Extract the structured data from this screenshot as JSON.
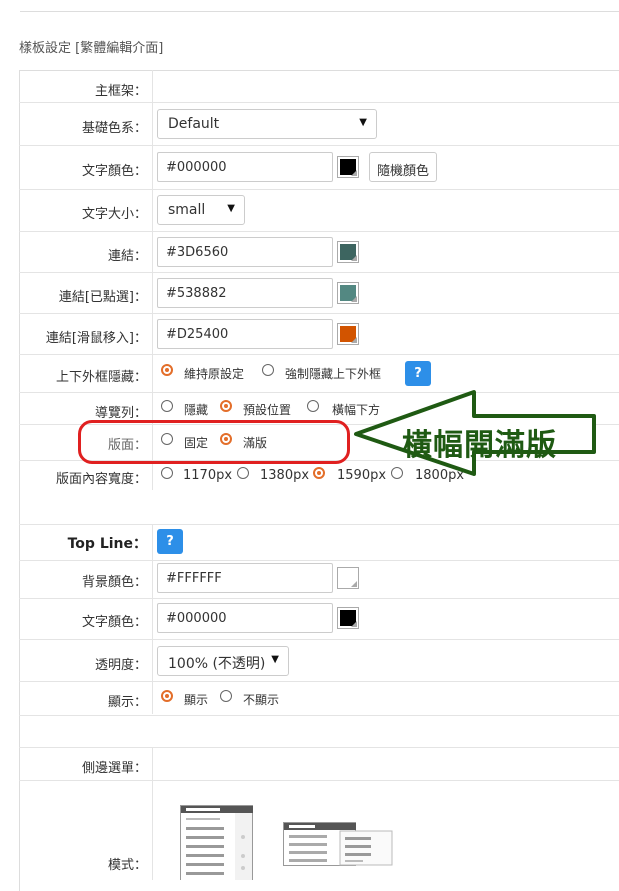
{
  "page": {
    "title": "樣板設定 [繁體編輯介面]"
  },
  "main_frame": {
    "heading": "主框架：",
    "base_color": {
      "label": "基礎色系：",
      "value": "Default"
    },
    "text_color": {
      "label": "文字顏色：",
      "value": "#000000",
      "swatch": "#000000",
      "random_button": "隨機顏色"
    },
    "text_size": {
      "label": "文字大小：",
      "value": "small"
    },
    "link": {
      "label": "連結：",
      "value": "#3D6560",
      "swatch": "#3D6560"
    },
    "link_visited": {
      "label": "連結[已點選]：",
      "value": "#538882",
      "swatch": "#538882"
    },
    "link_hover": {
      "label": "連結[滑鼠移入]：",
      "value": "#D25400",
      "swatch": "#D25400"
    },
    "outer_frame_hide": {
      "label": "上下外框隱藏：",
      "options": [
        "維持原設定",
        "強制隱藏上下外框"
      ],
      "selected": 0,
      "help": "?"
    },
    "navbar": {
      "label": "導覽列：",
      "options": [
        "隱藏",
        "預設位置",
        "橫幅下方"
      ],
      "selected": 1
    },
    "page_layout": {
      "label": "版面：",
      "options": [
        "固定",
        "滿版"
      ],
      "selected": 1
    },
    "content_width": {
      "label": "版面內容寬度：",
      "options": [
        "1170px",
        "1380px",
        "1590px",
        "1800px"
      ],
      "selected": 2
    }
  },
  "annotation": {
    "text": "橫幅開滿版",
    "arrow_color": "#1f5a13",
    "highlight_color": "#e02020"
  },
  "top_line": {
    "heading": "Top Line：",
    "help": "?",
    "bg_color": {
      "label": "背景顏色：",
      "value": "#FFFFFF",
      "swatch": "#FFFFFF"
    },
    "text_color": {
      "label": "文字顏色：",
      "value": "#000000",
      "swatch": "#000000"
    },
    "opacity": {
      "label": "透明度：",
      "value": "100% (不透明)"
    },
    "display": {
      "label": "顯示：",
      "options": [
        "顯示",
        "不顯示"
      ],
      "selected": 0
    }
  },
  "side_menu": {
    "heading": "側邊選單：",
    "style": {
      "label": "模式：",
      "options": [
        "layout-vertical-icon",
        "layout-overlay-icon"
      ]
    }
  }
}
